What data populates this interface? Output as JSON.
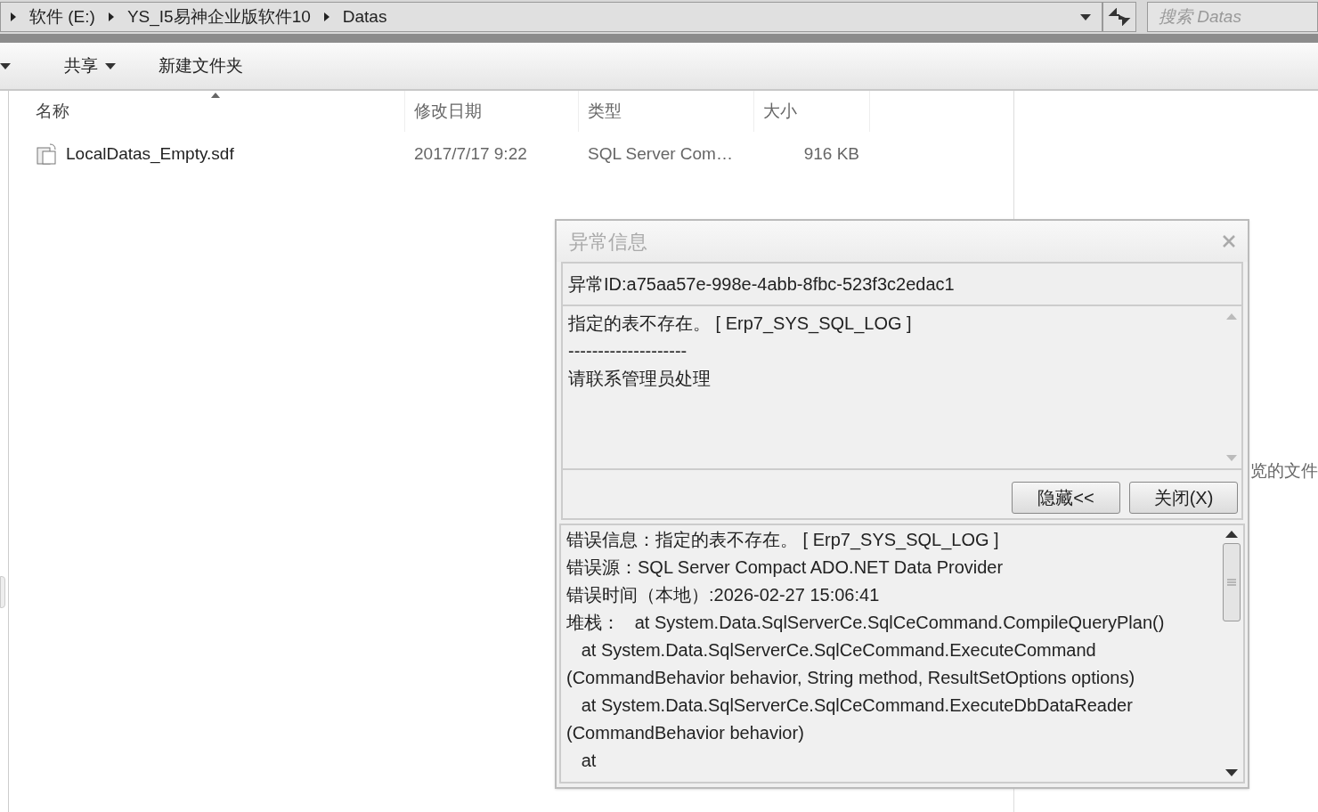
{
  "address_bar": {
    "breadcrumbs": [
      "软件 (E:)",
      "YS_I5易神企业版软件10",
      "Datas"
    ]
  },
  "search": {
    "placeholder": "搜索 Datas"
  },
  "toolbar": {
    "buttons": [
      {
        "label": "共享",
        "kind": "menu"
      },
      {
        "label": "新建文件夹",
        "kind": "plain"
      }
    ]
  },
  "file_list": {
    "columns": [
      {
        "label": "名称",
        "sorted": true
      },
      {
        "label": "修改日期",
        "sorted": false
      },
      {
        "label": "类型",
        "sorted": false
      },
      {
        "label": "大小",
        "sorted": false
      }
    ],
    "rows": [
      {
        "name": "LocalDatas_Empty.sdf",
        "modified": "2017/7/17 9:22",
        "type": "SQL Server Com…",
        "size": "916 KB"
      }
    ]
  },
  "preview_pane": {
    "text": "览的文件"
  },
  "dialog": {
    "title": "异常信息",
    "exception_id": "异常ID:a75aa57e-998e-4abb-8fbc-523f3c2edac1",
    "message_lines": [
      "指定的表不存在。 [ Erp7_SYS_SQL_LOG ]",
      "--------------------",
      "请联系管理员处理"
    ],
    "buttons": [
      "隐藏<<",
      "关闭(X)"
    ],
    "detail_lines": [
      "错误信息：指定的表不存在。 [ Erp7_SYS_SQL_LOG ]",
      "错误源：SQL Server Compact ADO.NET Data Provider",
      "错误时间（本地）:2026-02-27 15:06:41",
      "堆栈：   at System.Data.SqlServerCe.SqlCeCommand.CompileQueryPlan()",
      "   at System.Data.SqlServerCe.SqlCeCommand.ExecuteCommand",
      "(CommandBehavior behavior, String method, ResultSetOptions options)",
      "   at System.Data.SqlServerCe.SqlCeCommand.ExecuteDbDataReader",
      "(CommandBehavior behavior)",
      "   at"
    ]
  }
}
